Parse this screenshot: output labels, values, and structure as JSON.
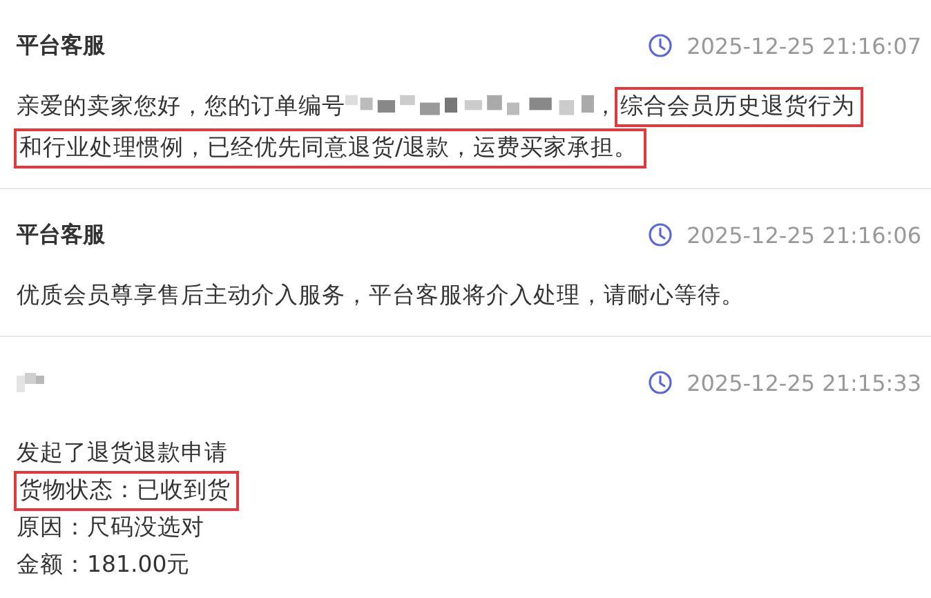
{
  "messages": [
    {
      "sender": {
        "kind": "text",
        "text": "平台客服"
      },
      "time": "2025-12-25 21:16:07",
      "lines": [
        {
          "segments": [
            {
              "kind": "text",
              "text": "亲爱的卖家您好，您的订单编号",
              "highlighted": false
            },
            {
              "kind": "redacted",
              "highlighted": false
            },
            {
              "kind": "text",
              "text": "，",
              "highlighted": false
            },
            {
              "kind": "text",
              "text": "综合会员历史退货行为",
              "highlighted": true
            }
          ]
        },
        {
          "segments": [
            {
              "kind": "text",
              "text": "和行业处理惯例，已经优先同意退货/退款，运费买家承担。",
              "highlighted": true
            }
          ]
        }
      ]
    },
    {
      "sender": {
        "kind": "text",
        "text": "平台客服"
      },
      "time": "2025-12-25 21:16:06",
      "lines": [
        {
          "segments": [
            {
              "kind": "text",
              "text": "优质会员尊享售后主动介入服务，平台客服将介入处理，请耐心等待。",
              "highlighted": false
            }
          ]
        }
      ]
    },
    {
      "sender": {
        "kind": "redacted"
      },
      "time": "2025-12-25 21:15:33",
      "lines": [
        {
          "segments": [
            {
              "kind": "text",
              "text": "发起了退货退款申请",
              "highlighted": false
            }
          ]
        },
        {
          "segments": [
            {
              "kind": "text",
              "text": "货物状态：已收到货",
              "highlighted": true
            }
          ]
        },
        {
          "segments": [
            {
              "kind": "text",
              "text": "原因：尺码没选对",
              "highlighted": false
            }
          ]
        },
        {
          "segments": [
            {
              "kind": "text",
              "text": "金额：181.00元",
              "highlighted": false
            }
          ]
        }
      ]
    }
  ]
}
